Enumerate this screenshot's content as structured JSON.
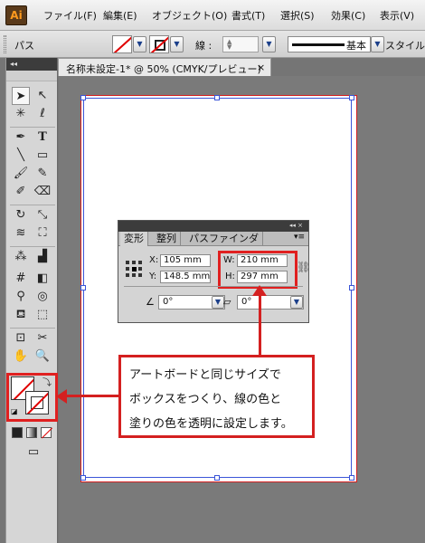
{
  "app": {
    "logo": "Ai"
  },
  "menu": {
    "items": [
      "ファイル(F)",
      "編集(E)",
      "オブジェクト(O)",
      "書式(T)",
      "選択(S)",
      "効果(C)",
      "表示(V)"
    ]
  },
  "control_bar": {
    "object_label": "パス",
    "stroke_label": "線 :",
    "brush_label": "基本",
    "style_label": "スタイル"
  },
  "tools_panel": {
    "collapse": "◂◂"
  },
  "document": {
    "tab_title": "名称未設定-1* @ 50% (CMYK/プレビュー)",
    "close": "×"
  },
  "transform_panel": {
    "tabs": [
      "変形",
      "整列",
      "パスファインダ"
    ],
    "header_controls": "◂◂ ×",
    "menu": "▾≡",
    "x_label": "X:",
    "x_value": "105 mm",
    "y_label": "Y:",
    "y_value": "148.5 mm",
    "w_label": "W:",
    "w_value": "210 mm",
    "h_label": "H:",
    "h_value": "297 mm",
    "rotate_value": "0°",
    "shear_value": "0°"
  },
  "callout": {
    "lines": [
      "アートボードと同じサイズで",
      "ボックスをつくり、線の色と",
      "塗りの色を透明に設定します。"
    ]
  },
  "colors": {
    "highlight": "#d42020",
    "artboard_guide": "#3b55d8",
    "none_swatch": "#e00000"
  }
}
